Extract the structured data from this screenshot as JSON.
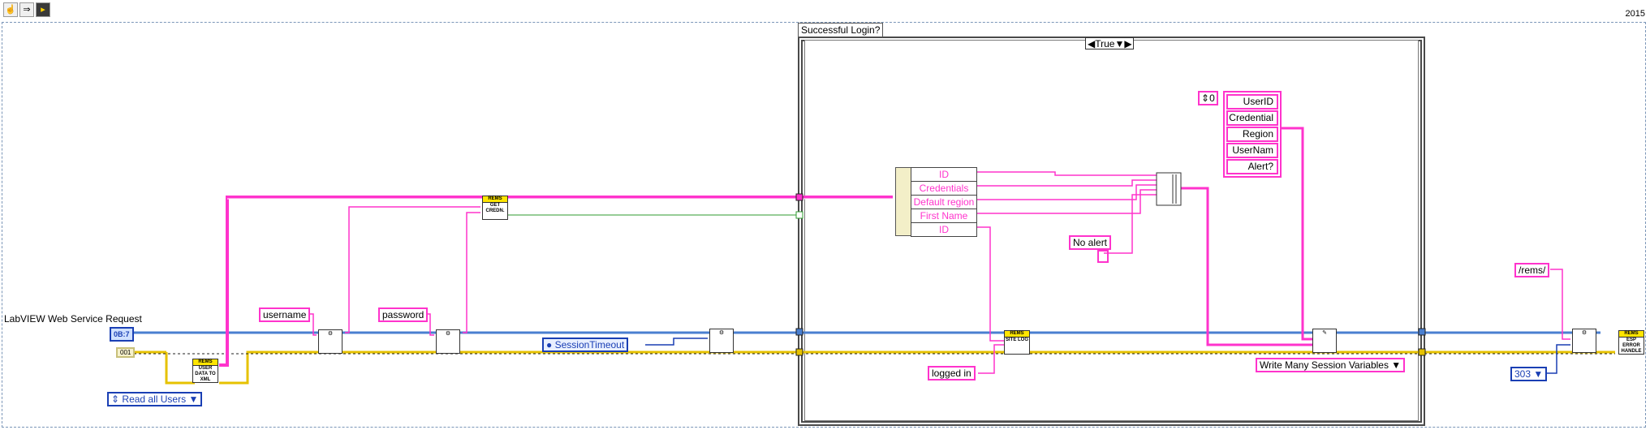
{
  "version_label": "2015",
  "case_structure": {
    "label": "Successful Login?",
    "selector_value": "True"
  },
  "web_request_label": "LabVIEW Web Service Request",
  "terminals": {
    "request_ref": "0B:7",
    "small_const": "001"
  },
  "string_constants": {
    "username": "username",
    "password": "password",
    "no_alert": "No alert",
    "logged_in": "logged in",
    "redirect_path": "/rems/"
  },
  "enum_constants": {
    "read_all_users": "Read all Users",
    "session_timeout": "SessionTimeout",
    "write_many": "Write Many Session Variables",
    "status_code": "303"
  },
  "subvis": {
    "user_data_to_xml": {
      "header": "REMS",
      "body": "USER DATA TO XML"
    },
    "get_creds": {
      "header": "REMS",
      "body": "GET CREDN."
    },
    "site_log": {
      "header": "REMS",
      "body": "SITE LOG"
    },
    "esp_error": {
      "header": "REMS",
      "body": "ESP ERROR HANDLE"
    }
  },
  "unbundle_fields": [
    "ID",
    "Credentials",
    "Default region",
    "First Name",
    "ID"
  ],
  "array_index": "0",
  "session_var_names": [
    "UserID",
    "Credential",
    "Region",
    "UserNam",
    "Alert?"
  ],
  "colors": {
    "string_wire": "#ff33cc",
    "ref_wire": "#4a7fd0",
    "error_wire": "#e6c200",
    "bool_wire": "#2f9b2f"
  }
}
